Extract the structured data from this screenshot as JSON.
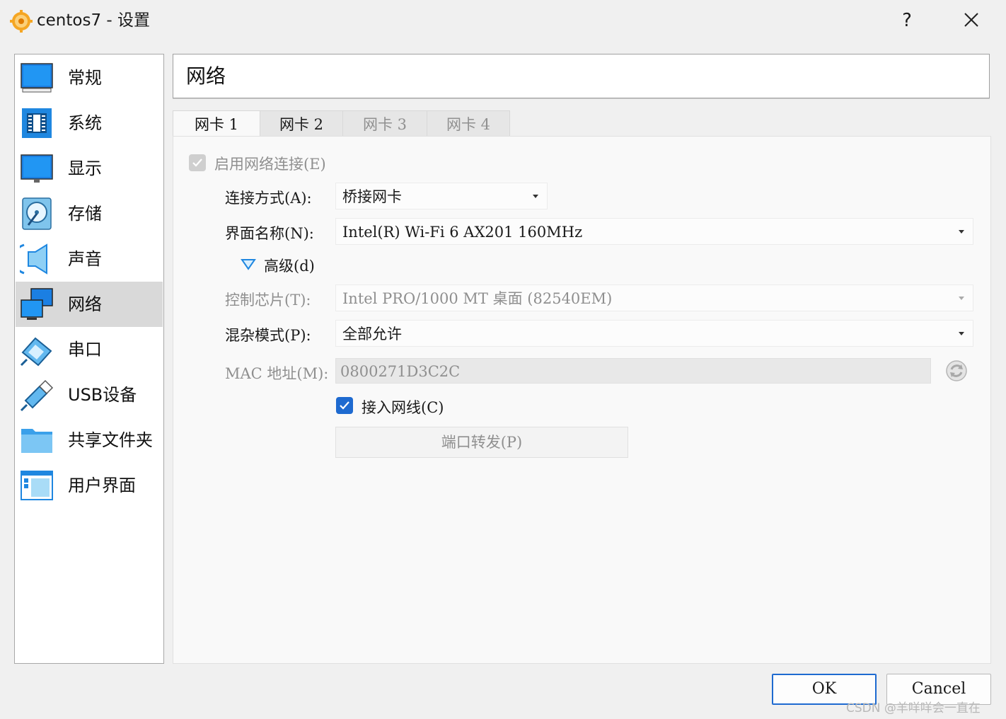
{
  "window": {
    "title": "centos7 - 设置",
    "help_label": "?"
  },
  "sidebar": {
    "items": [
      {
        "label": "常规",
        "icon": "monitor-icon"
      },
      {
        "label": "系统",
        "icon": "chip-icon"
      },
      {
        "label": "显示",
        "icon": "display-icon"
      },
      {
        "label": "存储",
        "icon": "disk-icon"
      },
      {
        "label": "声音",
        "icon": "speaker-icon"
      },
      {
        "label": "网络",
        "icon": "network-icon",
        "selected": true
      },
      {
        "label": "串口",
        "icon": "serial-port-icon"
      },
      {
        "label": "USB设备",
        "icon": "usb-icon"
      },
      {
        "label": "共享文件夹",
        "icon": "folder-icon"
      },
      {
        "label": "用户界面",
        "icon": "window-icon"
      }
    ]
  },
  "page": {
    "title": "网络"
  },
  "tabs": [
    {
      "label": "网卡 1",
      "active": true
    },
    {
      "label": "网卡 2"
    },
    {
      "label": "网卡 3",
      "dim": true
    },
    {
      "label": "网卡 4",
      "dim": true
    }
  ],
  "form": {
    "enable_label": "启用网络连接(E)",
    "attach_label": "连接方式(A):",
    "attach_value": "桥接网卡",
    "name_label": "界面名称(N):",
    "name_value": "Intel(R) Wi-Fi 6 AX201 160MHz",
    "advanced_label": "高级(d)",
    "adapter_label": "控制芯片(T):",
    "adapter_value": "Intel PRO/1000 MT 桌面 (82540EM)",
    "promisc_label": "混杂模式(P):",
    "promisc_value": "全部允许",
    "mac_label": "MAC 地址(M):",
    "mac_value": "0800271D3C2C",
    "cable_label": "接入网线(C)",
    "port_forward_label": "端口转发(P)"
  },
  "footer": {
    "ok_label": "OK",
    "cancel_label": "Cancel"
  },
  "watermark": "CSDN @羊咩咩会一直在",
  "colors": {
    "accent": "#1e6ad0",
    "selected_bg": "#d9d9d9",
    "disabled_text": "#8f8f8f"
  }
}
